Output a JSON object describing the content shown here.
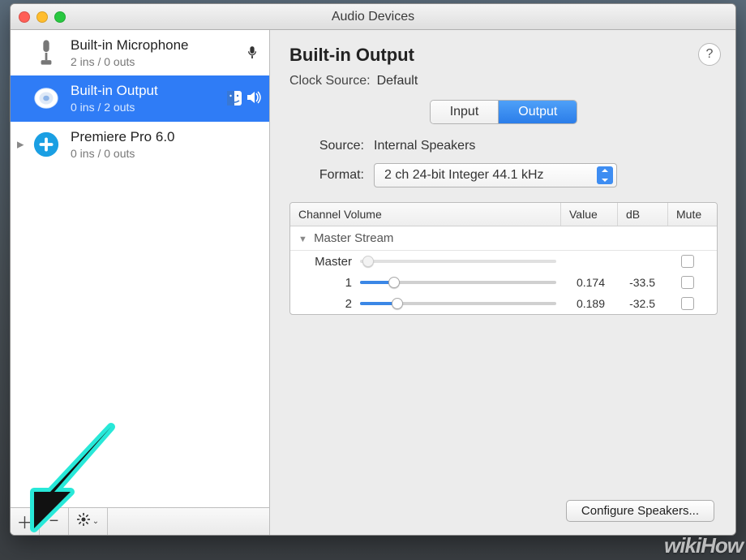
{
  "window": {
    "title": "Audio Devices"
  },
  "sidebar": {
    "devices": [
      {
        "name": "Built-in Microphone",
        "sub": "2 ins / 0 outs"
      },
      {
        "name": "Built-in Output",
        "sub": "0 ins / 2 outs"
      },
      {
        "name": "Premiere Pro 6.0",
        "sub": "0 ins / 0 outs"
      }
    ],
    "footer": {
      "add": "+",
      "remove": "−",
      "gear": "✽"
    }
  },
  "main": {
    "title": "Built-in Output",
    "clock_source_label": "Clock Source:",
    "clock_source_value": "Default",
    "tabs": {
      "input": "Input",
      "output": "Output",
      "active": "output"
    },
    "source_label": "Source:",
    "source_value": "Internal Speakers",
    "format_label": "Format:",
    "format_value": "2 ch 24-bit Integer 44.1 kHz",
    "help": "?",
    "table": {
      "headers": {
        "name": "Channel Volume",
        "value": "Value",
        "db": "dB",
        "mute": "Mute"
      },
      "section": "Master Stream",
      "rows": [
        {
          "label": "Master",
          "value": "",
          "db": "",
          "fill_pct": 0,
          "disabled": true
        },
        {
          "label": "1",
          "value": "0.174",
          "db": "-33.5",
          "fill_pct": 17.4,
          "disabled": false
        },
        {
          "label": "2",
          "value": "0.189",
          "db": "-32.5",
          "fill_pct": 18.9,
          "disabled": false
        }
      ]
    },
    "configure_button": "Configure Speakers..."
  },
  "watermark": "wikiHow"
}
